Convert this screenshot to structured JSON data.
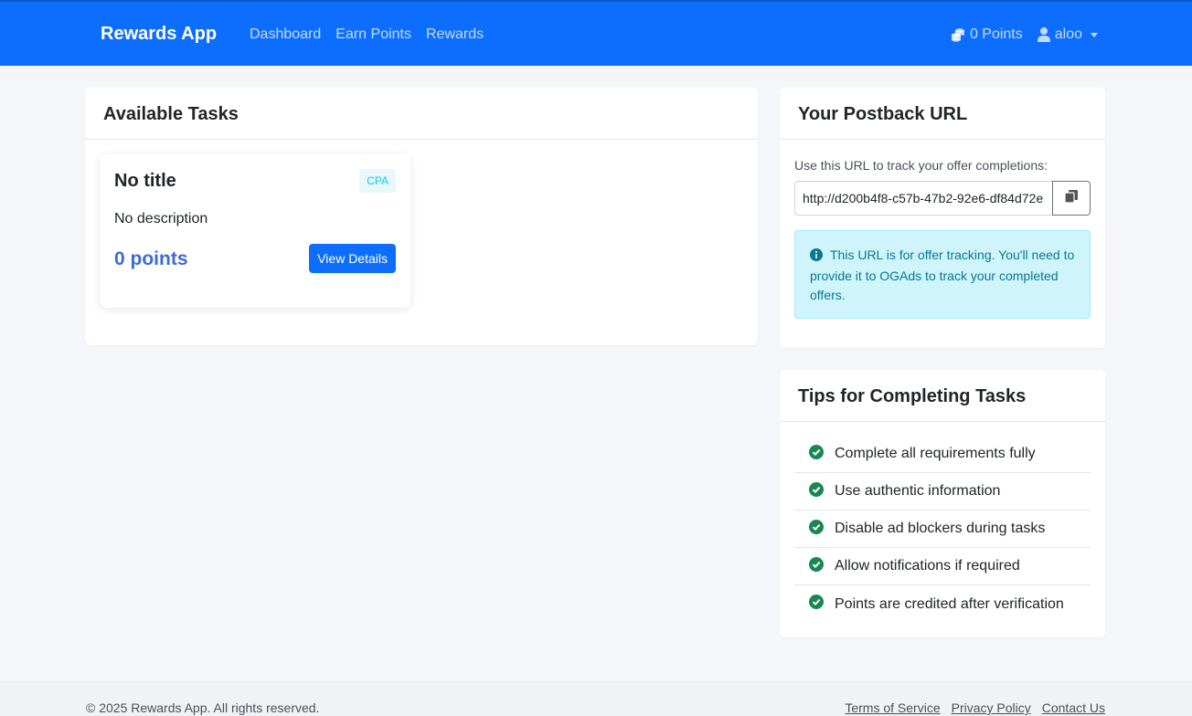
{
  "navbar": {
    "brand": "Rewards App",
    "links": [
      "Dashboard",
      "Earn Points",
      "Rewards"
    ],
    "points": "0 Points",
    "user": "aloo",
    "bg_color": "#0d6efd"
  },
  "tasks": {
    "title": "Available Tasks",
    "items": [
      {
        "title": "No title",
        "badge": "CPA",
        "description": "No description",
        "points": "0 points",
        "button": "View Details"
      }
    ]
  },
  "postback": {
    "title": "Your Postback URL",
    "label": "Use this URL to track your offer completions:",
    "url": "http://d200b4f8-c57b-47b2-92e6-df84d72e",
    "info": "This URL is for offer tracking. You'll need to provide it to OGAds to track your completed offers."
  },
  "tips": {
    "title": "Tips for Completing Tasks",
    "items": [
      "Complete all requirements fully",
      "Use authentic information",
      "Disable ad blockers during tasks",
      "Allow notifications if required",
      "Points are credited after verification"
    ],
    "check_color": "#198754"
  },
  "footer": {
    "copyright": "© 2025 Rewards App. All rights reserved.",
    "links": [
      "Terms of Service",
      "Privacy Policy",
      "Contact Us"
    ]
  }
}
